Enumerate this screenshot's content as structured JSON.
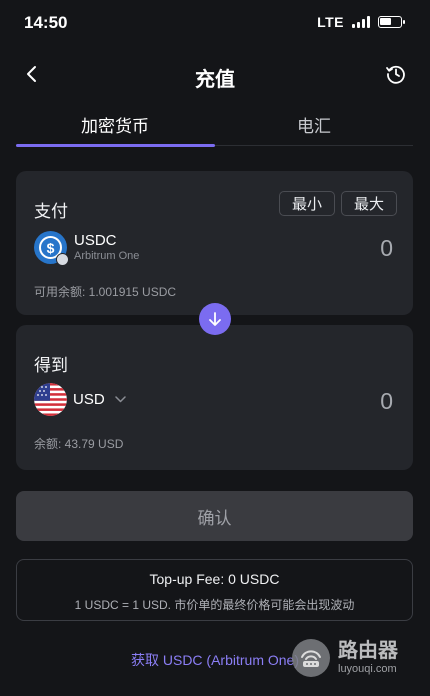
{
  "status_bar": {
    "time": "14:50",
    "network": "LTE",
    "battery_level": 0.6
  },
  "header": {
    "title": "充值"
  },
  "tabs": [
    {
      "label": "加密货币",
      "active": true
    },
    {
      "label": "电汇",
      "active": false
    }
  ],
  "pay": {
    "label": "支付",
    "min_label": "最小",
    "max_label": "最大",
    "token_symbol": "USDC",
    "token_network": "Arbitrum One",
    "amount": "0",
    "balance_text": "可用余额: 1.001915 USDC"
  },
  "receive": {
    "label": "得到",
    "currency": "USD",
    "amount": "0",
    "balance_text": "余额: 43.79 USD"
  },
  "confirm_label": "确认",
  "fee": {
    "title": "Top-up Fee: 0 USDC",
    "note": "1 USDC = 1 USD. 市价单的最终价格可能会出现波动"
  },
  "get_link": "获取 USDC (Arbitrum One)",
  "watermark": {
    "name_cn": "路由器",
    "domain": "luyouqi.com"
  },
  "colors": {
    "accent": "#7b6cf0",
    "background": "#141518",
    "card": "#24262b",
    "usdc_blue": "#2775ca"
  }
}
